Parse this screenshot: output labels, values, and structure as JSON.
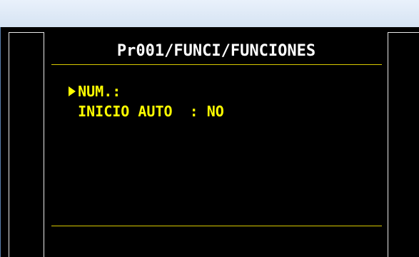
{
  "screen": {
    "title": "Pr001/FUNCI/FUNCIONES"
  },
  "menu": {
    "items": [
      {
        "label": "NUM.:",
        "value": "",
        "selected": true
      },
      {
        "label": "INICIO AUTO  :",
        "value": " NO",
        "selected": false
      }
    ]
  },
  "colors": {
    "background": "#000000",
    "title": "#ffffff",
    "menu_text": "#ffff00",
    "divider": "#d8c800"
  },
  "icons": {
    "cursor": "selection-arrow-icon"
  }
}
